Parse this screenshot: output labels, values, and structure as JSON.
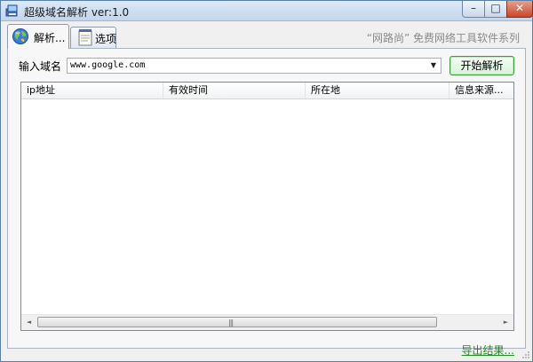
{
  "window": {
    "title": "超级域名解析 ver:1.0",
    "controls": {
      "minimize": "–",
      "maximize": "□",
      "close": "✕"
    }
  },
  "tabs": [
    {
      "label": "解析...",
      "icon": "globe-icon",
      "active": true
    },
    {
      "label": "选项",
      "icon": "notepad-icon",
      "active": false
    }
  ],
  "slogan": "“网路尚” 免费网络工具软件系列",
  "form": {
    "domain_label": "输入域名",
    "domain_value": "www.google.com",
    "start_button": "开始解析"
  },
  "table": {
    "columns": [
      "ip地址",
      "有效时间",
      "所在地",
      "信息来源..."
    ],
    "rows": []
  },
  "scrollbar": {
    "left": "◄",
    "right": "►",
    "grip": "|||"
  },
  "export_link": "导出结果...",
  "colors": {
    "accent_green": "#1d8f1d",
    "title_blue": "#c3d6ec",
    "close_red": "#c4482c"
  }
}
